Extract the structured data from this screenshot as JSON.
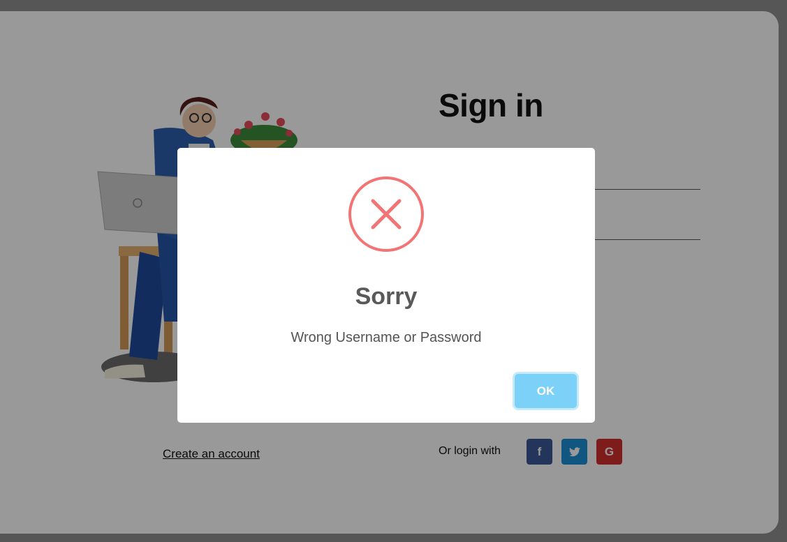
{
  "login": {
    "title": "Sign in",
    "create_account_link": "Create an account",
    "or_login_with": "Or login with",
    "social": [
      {
        "name": "facebook",
        "glyph": "f",
        "color": "#3b5998"
      },
      {
        "name": "twitter",
        "glyph": "❧",
        "color": "#1d8fd6"
      },
      {
        "name": "google",
        "glyph": "G",
        "color": "#d32f2f"
      }
    ]
  },
  "modal": {
    "icon": "error-x-icon",
    "title": "Sorry",
    "text": "Wrong Username or Password",
    "ok_label": "OK",
    "accent_color": "#f27474",
    "button_color": "#7cd1f9"
  },
  "illustration": {
    "icon": "person-with-laptop-illustration"
  }
}
